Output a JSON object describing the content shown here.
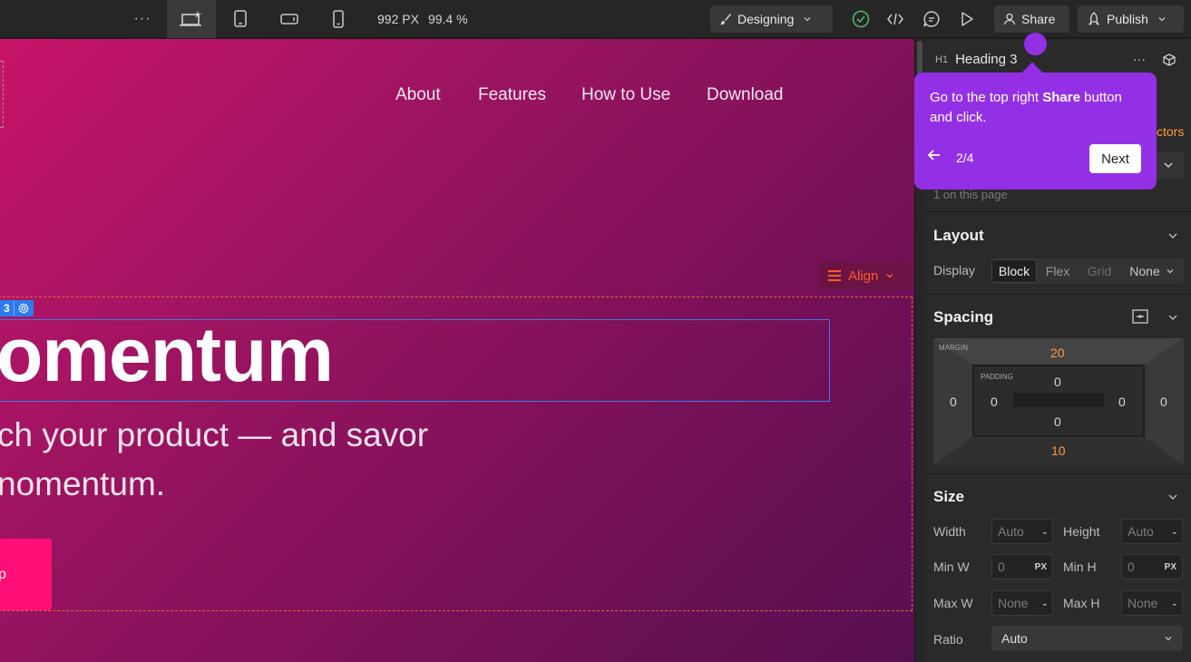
{
  "topbar": {
    "more_label": "···",
    "size_px": "992 PX",
    "zoom": "99.4 %",
    "mode_label": "Designing",
    "share_label": "Share",
    "publish_label": "Publish"
  },
  "canvas": {
    "nav": [
      "About",
      "Features",
      "How to Use",
      "Download"
    ],
    "align_label": "Align",
    "selection_tag": "3",
    "heading": "omentum",
    "paragraph_line1": "ch your product — and savor",
    "paragraph_line2": "nomentum.",
    "cta_label": "p"
  },
  "panel": {
    "element_type": "H1",
    "element_name": "Heading 3",
    "selectors_link": "ctors",
    "count_text": "1 on this page",
    "layout": {
      "title": "Layout",
      "display_label": "Display",
      "display_options": [
        "Block",
        "Flex",
        "Grid"
      ],
      "display_none": "None",
      "selected": "Block"
    },
    "spacing": {
      "title": "Spacing",
      "margin_label": "MARGIN",
      "padding_label": "PADDING",
      "margin_top": "20",
      "margin_bottom": "10",
      "margin_left": "0",
      "margin_right": "0",
      "padding_top": "0",
      "padding_bottom": "0",
      "padding_left": "0",
      "padding_right": "0"
    },
    "size": {
      "title": "Size",
      "width_label": "Width",
      "width_value": "Auto",
      "height_label": "Height",
      "height_value": "Auto",
      "minw_label": "Min W",
      "minw_value": "0",
      "minh_label": "Min H",
      "minh_value": "0",
      "unit": "PX",
      "maxw_label": "Max W",
      "maxw_value": "None",
      "maxh_label": "Max H",
      "maxh_value": "None",
      "ratio_label": "Ratio",
      "ratio_value": "Auto",
      "dash": "-"
    }
  },
  "tooltip": {
    "text_before": "Go to the top right ",
    "text_bold": "Share",
    "text_after": " button and click.",
    "step": "2/4",
    "next_label": "Next"
  },
  "colors": {
    "accent_purple": "#9330e6",
    "canvas_top": "#c8146a",
    "canvas_bottom": "#561050",
    "cta_pink": "#ff0f77",
    "align_orange": "#ff5a2a"
  }
}
